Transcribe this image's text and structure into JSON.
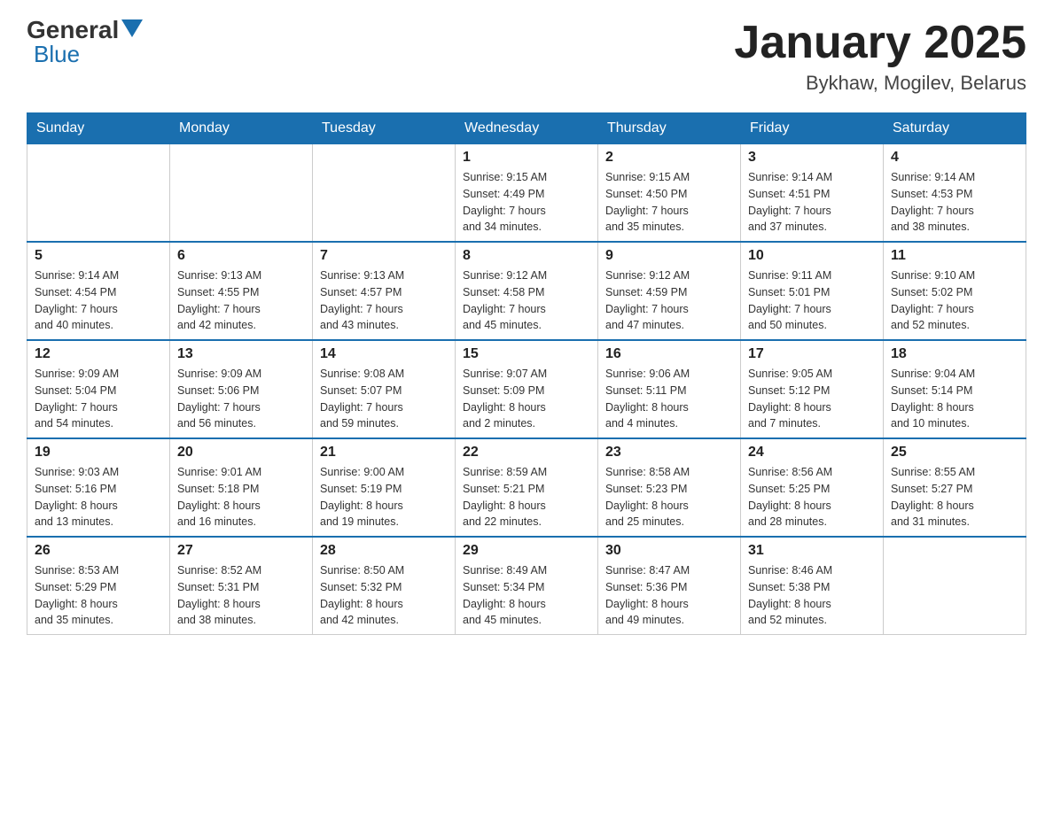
{
  "header": {
    "logo_general": "General",
    "logo_blue": "Blue",
    "month_title": "January 2025",
    "location": "Bykhaw, Mogilev, Belarus"
  },
  "weekdays": [
    "Sunday",
    "Monday",
    "Tuesday",
    "Wednesday",
    "Thursday",
    "Friday",
    "Saturday"
  ],
  "weeks": [
    [
      {
        "day": "",
        "info": ""
      },
      {
        "day": "",
        "info": ""
      },
      {
        "day": "",
        "info": ""
      },
      {
        "day": "1",
        "info": "Sunrise: 9:15 AM\nSunset: 4:49 PM\nDaylight: 7 hours\nand 34 minutes."
      },
      {
        "day": "2",
        "info": "Sunrise: 9:15 AM\nSunset: 4:50 PM\nDaylight: 7 hours\nand 35 minutes."
      },
      {
        "day": "3",
        "info": "Sunrise: 9:14 AM\nSunset: 4:51 PM\nDaylight: 7 hours\nand 37 minutes."
      },
      {
        "day": "4",
        "info": "Sunrise: 9:14 AM\nSunset: 4:53 PM\nDaylight: 7 hours\nand 38 minutes."
      }
    ],
    [
      {
        "day": "5",
        "info": "Sunrise: 9:14 AM\nSunset: 4:54 PM\nDaylight: 7 hours\nand 40 minutes."
      },
      {
        "day": "6",
        "info": "Sunrise: 9:13 AM\nSunset: 4:55 PM\nDaylight: 7 hours\nand 42 minutes."
      },
      {
        "day": "7",
        "info": "Sunrise: 9:13 AM\nSunset: 4:57 PM\nDaylight: 7 hours\nand 43 minutes."
      },
      {
        "day": "8",
        "info": "Sunrise: 9:12 AM\nSunset: 4:58 PM\nDaylight: 7 hours\nand 45 minutes."
      },
      {
        "day": "9",
        "info": "Sunrise: 9:12 AM\nSunset: 4:59 PM\nDaylight: 7 hours\nand 47 minutes."
      },
      {
        "day": "10",
        "info": "Sunrise: 9:11 AM\nSunset: 5:01 PM\nDaylight: 7 hours\nand 50 minutes."
      },
      {
        "day": "11",
        "info": "Sunrise: 9:10 AM\nSunset: 5:02 PM\nDaylight: 7 hours\nand 52 minutes."
      }
    ],
    [
      {
        "day": "12",
        "info": "Sunrise: 9:09 AM\nSunset: 5:04 PM\nDaylight: 7 hours\nand 54 minutes."
      },
      {
        "day": "13",
        "info": "Sunrise: 9:09 AM\nSunset: 5:06 PM\nDaylight: 7 hours\nand 56 minutes."
      },
      {
        "day": "14",
        "info": "Sunrise: 9:08 AM\nSunset: 5:07 PM\nDaylight: 7 hours\nand 59 minutes."
      },
      {
        "day": "15",
        "info": "Sunrise: 9:07 AM\nSunset: 5:09 PM\nDaylight: 8 hours\nand 2 minutes."
      },
      {
        "day": "16",
        "info": "Sunrise: 9:06 AM\nSunset: 5:11 PM\nDaylight: 8 hours\nand 4 minutes."
      },
      {
        "day": "17",
        "info": "Sunrise: 9:05 AM\nSunset: 5:12 PM\nDaylight: 8 hours\nand 7 minutes."
      },
      {
        "day": "18",
        "info": "Sunrise: 9:04 AM\nSunset: 5:14 PM\nDaylight: 8 hours\nand 10 minutes."
      }
    ],
    [
      {
        "day": "19",
        "info": "Sunrise: 9:03 AM\nSunset: 5:16 PM\nDaylight: 8 hours\nand 13 minutes."
      },
      {
        "day": "20",
        "info": "Sunrise: 9:01 AM\nSunset: 5:18 PM\nDaylight: 8 hours\nand 16 minutes."
      },
      {
        "day": "21",
        "info": "Sunrise: 9:00 AM\nSunset: 5:19 PM\nDaylight: 8 hours\nand 19 minutes."
      },
      {
        "day": "22",
        "info": "Sunrise: 8:59 AM\nSunset: 5:21 PM\nDaylight: 8 hours\nand 22 minutes."
      },
      {
        "day": "23",
        "info": "Sunrise: 8:58 AM\nSunset: 5:23 PM\nDaylight: 8 hours\nand 25 minutes."
      },
      {
        "day": "24",
        "info": "Sunrise: 8:56 AM\nSunset: 5:25 PM\nDaylight: 8 hours\nand 28 minutes."
      },
      {
        "day": "25",
        "info": "Sunrise: 8:55 AM\nSunset: 5:27 PM\nDaylight: 8 hours\nand 31 minutes."
      }
    ],
    [
      {
        "day": "26",
        "info": "Sunrise: 8:53 AM\nSunset: 5:29 PM\nDaylight: 8 hours\nand 35 minutes."
      },
      {
        "day": "27",
        "info": "Sunrise: 8:52 AM\nSunset: 5:31 PM\nDaylight: 8 hours\nand 38 minutes."
      },
      {
        "day": "28",
        "info": "Sunrise: 8:50 AM\nSunset: 5:32 PM\nDaylight: 8 hours\nand 42 minutes."
      },
      {
        "day": "29",
        "info": "Sunrise: 8:49 AM\nSunset: 5:34 PM\nDaylight: 8 hours\nand 45 minutes."
      },
      {
        "day": "30",
        "info": "Sunrise: 8:47 AM\nSunset: 5:36 PM\nDaylight: 8 hours\nand 49 minutes."
      },
      {
        "day": "31",
        "info": "Sunrise: 8:46 AM\nSunset: 5:38 PM\nDaylight: 8 hours\nand 52 minutes."
      },
      {
        "day": "",
        "info": ""
      }
    ]
  ]
}
